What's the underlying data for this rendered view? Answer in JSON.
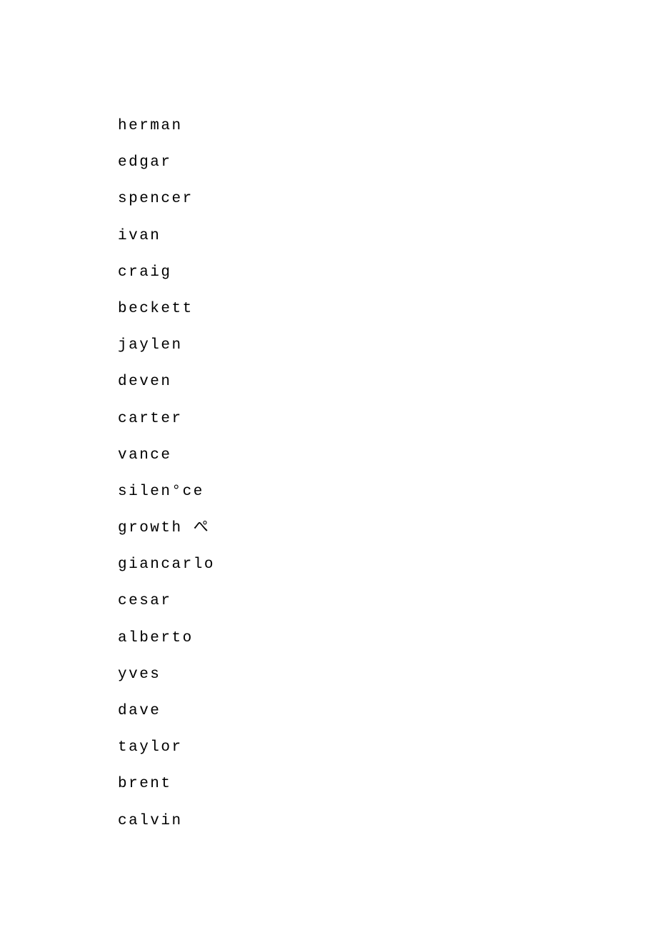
{
  "items": [
    "herman",
    "edgar",
    "spencer",
    "ivan",
    "craig",
    "beckett",
    "jaylen",
    "deven",
    "carter",
    "vance",
    "silen°ce",
    "growth ぺ",
    "giancarlo",
    "cesar",
    "alberto",
    "yves",
    "dave",
    "taylor",
    "brent",
    "calvin"
  ]
}
